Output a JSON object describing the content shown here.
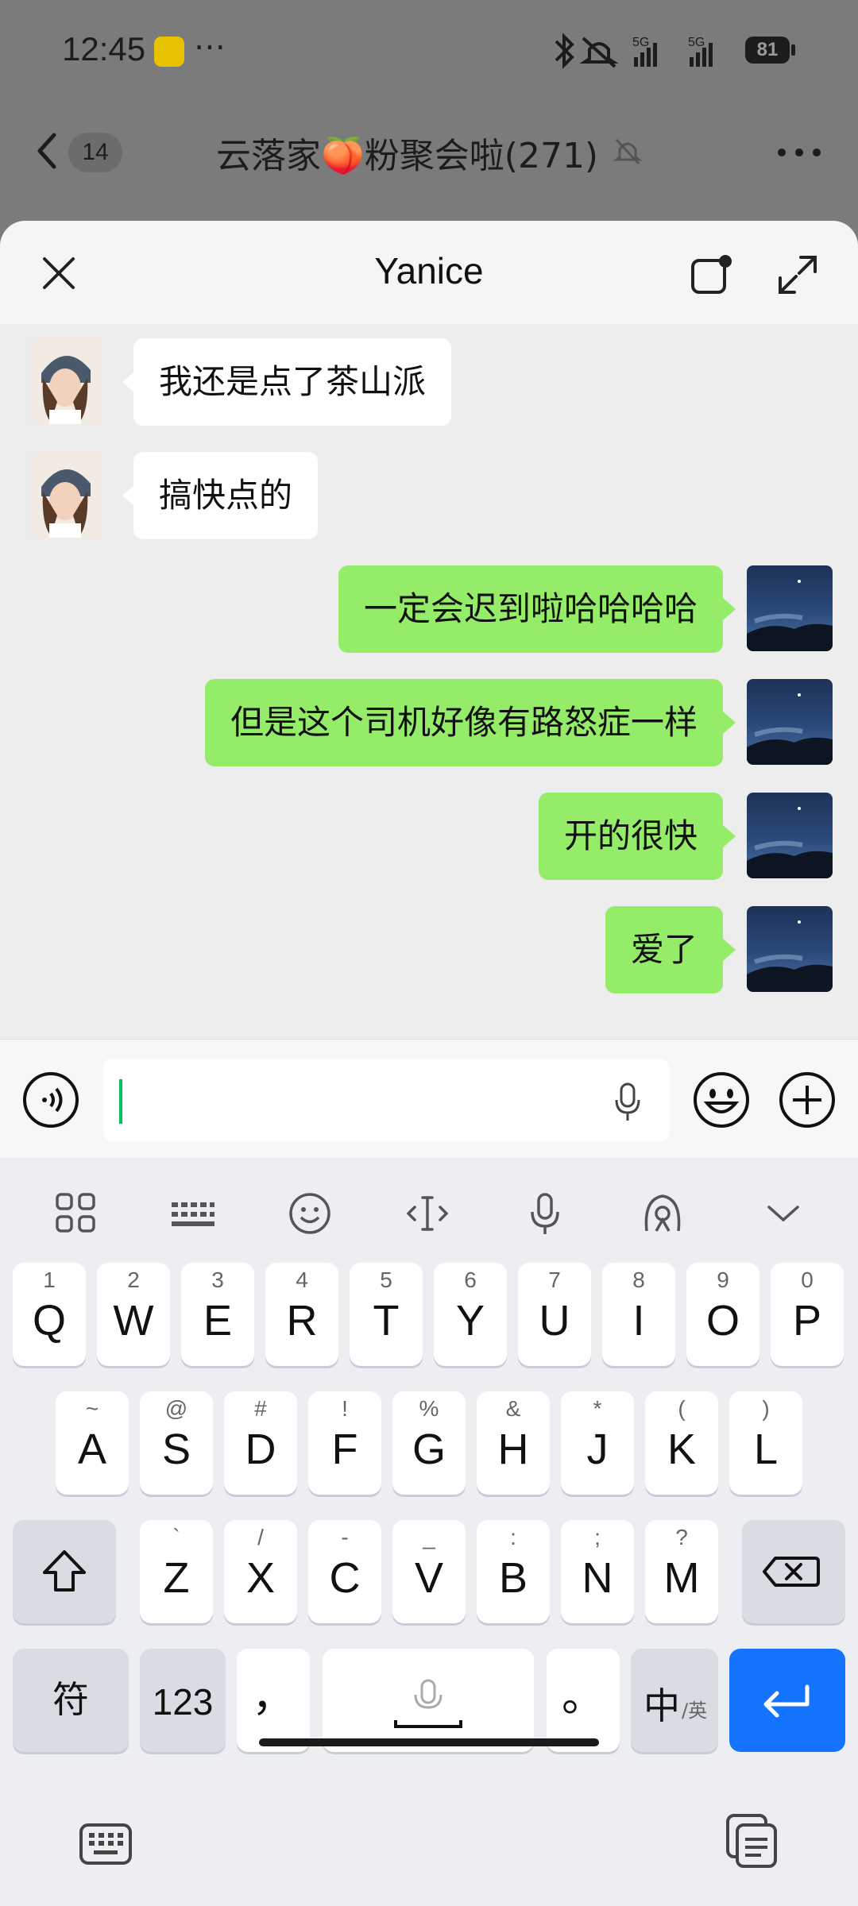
{
  "status_bar": {
    "time": "12:45",
    "more": "⋯",
    "battery": "81",
    "signal_1": "5G",
    "signal_2": "5G"
  },
  "chat_header": {
    "unread_count": "14",
    "group_name": "云落家🍑粉聚会啦(271)"
  },
  "sheet": {
    "title": "Yanice"
  },
  "messages": [
    {
      "side": "left",
      "text": "我还是点了茶山派"
    },
    {
      "side": "left",
      "text": "搞快点的"
    },
    {
      "side": "right",
      "text": "一定会迟到啦哈哈哈哈"
    },
    {
      "side": "right",
      "text": "但是这个司机好像有路怒症一样"
    },
    {
      "side": "right",
      "text": "开的很快"
    },
    {
      "side": "right",
      "text": "爱了"
    }
  ],
  "input": {
    "value": ""
  },
  "keyboard": {
    "row1": [
      {
        "k": "Q",
        "s": "1"
      },
      {
        "k": "W",
        "s": "2"
      },
      {
        "k": "E",
        "s": "3"
      },
      {
        "k": "R",
        "s": "4"
      },
      {
        "k": "T",
        "s": "5"
      },
      {
        "k": "Y",
        "s": "6"
      },
      {
        "k": "U",
        "s": "7"
      },
      {
        "k": "I",
        "s": "8"
      },
      {
        "k": "O",
        "s": "9"
      },
      {
        "k": "P",
        "s": "0"
      }
    ],
    "row2": [
      {
        "k": "A",
        "s": "~"
      },
      {
        "k": "S",
        "s": "@"
      },
      {
        "k": "D",
        "s": "#"
      },
      {
        "k": "F",
        "s": "!"
      },
      {
        "k": "G",
        "s": "%"
      },
      {
        "k": "H",
        "s": "&"
      },
      {
        "k": "J",
        "s": "*"
      },
      {
        "k": "K",
        "s": "("
      },
      {
        "k": "L",
        "s": ")"
      }
    ],
    "row3": [
      {
        "k": "Z",
        "s": "`"
      },
      {
        "k": "X",
        "s": "/"
      },
      {
        "k": "C",
        "s": "-"
      },
      {
        "k": "V",
        "s": "_"
      },
      {
        "k": "B",
        "s": ":"
      },
      {
        "k": "N",
        "s": ";"
      },
      {
        "k": "M",
        "s": "?"
      }
    ],
    "symbol_key": "符",
    "num_key": "123",
    "comma_key": "，",
    "period_key": "。",
    "lang_key_main": "中",
    "lang_key_sub": "/英"
  },
  "colors": {
    "bubble_right": "#95ec69",
    "bubble_left": "#ffffff",
    "enter_key": "#1473ff",
    "caret": "#07c160"
  }
}
